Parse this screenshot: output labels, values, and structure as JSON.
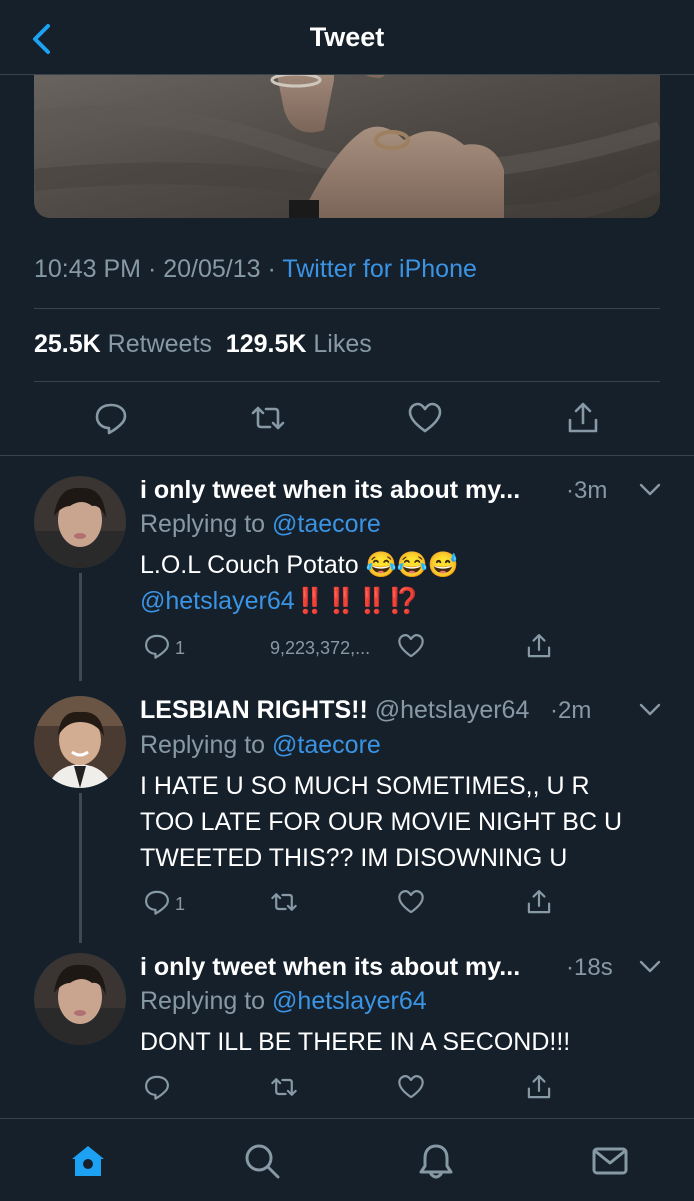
{
  "header": {
    "title": "Tweet"
  },
  "tweet": {
    "time": "10:43 PM",
    "date": "20/05/13",
    "source": "Twitter for iPhone",
    "retweets_count": "25.5K",
    "retweets_label": "Retweets",
    "likes_count": "129.5K",
    "likes_label": "Likes"
  },
  "replies": [
    {
      "name": "i only tweet when its about my...",
      "handle": "",
      "time": "3m",
      "replying_label": "Replying to",
      "replying_to": "@taecore",
      "text_line1": "L.O.L Couch Potato 😂😂😅",
      "text_mention": "@hetslayer64",
      "text_marks": "‼️‼️‼️⁉️",
      "reply_count": "1",
      "like_count": "9,223,372,..."
    },
    {
      "name": "LESBIAN RIGHTS!!",
      "handle": "@hetslayer64",
      "time": "2m",
      "replying_label": "Replying to",
      "replying_to": "@taecore",
      "text_line1": "I HATE U SO MUCH SOMETIMES,, U R",
      "text_line2": "TOO LATE FOR OUR MOVIE NIGHT BC U",
      "text_line3": "TWEETED THIS?? IM DISOWNING U",
      "reply_count": "1"
    },
    {
      "name": "i only tweet when its about my...",
      "handle": "",
      "time": "18s",
      "replying_label": "Replying to",
      "replying_to": "@hetslayer64",
      "text_line1": "DONT ILL BE THERE IN A SECOND!!!"
    }
  ],
  "tabbar": {
    "items": [
      "home-icon",
      "search-icon",
      "bell-icon",
      "mail-icon"
    ],
    "active_color": "#1da1f2"
  },
  "colors": {
    "background": "#15202b",
    "accent": "#1da1f2",
    "muted": "#8899a6",
    "divider": "#38444d"
  }
}
